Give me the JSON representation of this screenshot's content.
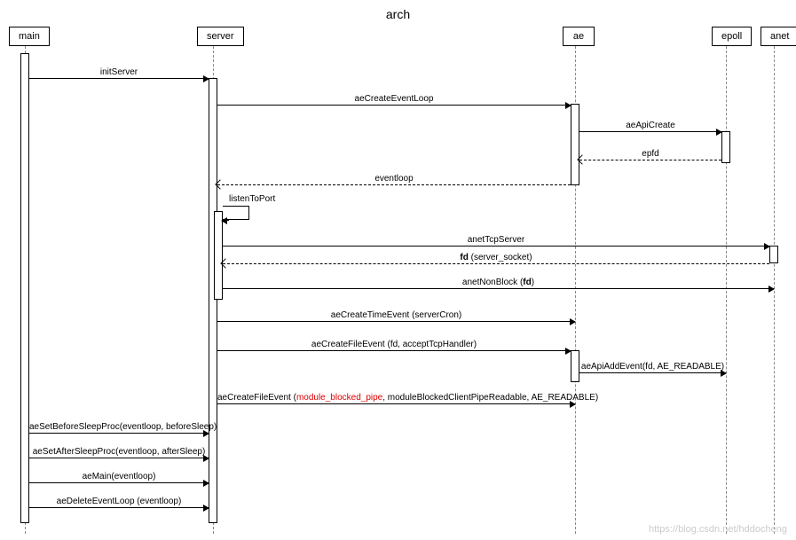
{
  "title": "arch",
  "participants": {
    "main": "main",
    "server": "server",
    "ae": "ae",
    "epoll": "epoll",
    "anet": "anet"
  },
  "messages": {
    "initServer": "initServer",
    "aeCreateEventLoop": "aeCreateEventLoop",
    "aeApiCreate": "aeApiCreate",
    "epfd": "epfd",
    "eventloop": "eventloop",
    "listenToPort": "listenToPort",
    "anetTcpServer": "anetTcpServer",
    "fdReturnPrefix": "fd",
    "fdReturnSuffix": " (server_socket)",
    "anetNonBlockPrefix": "anetNonBlock (",
    "anetNonBlockBold": "fd",
    "anetNonBlockSuffix": ")",
    "aeCreateTimeEvent": "aeCreateTimeEvent (serverCron)",
    "aeCreateFileEvent1": "aeCreateFileEvent (fd, acceptTcpHandler)",
    "aeApiAddEvent": "aeApiAddEvent(fd, AE_READABLE)",
    "aeCreateFileEvent2pre": "aeCreateFileEvent (",
    "aeCreateFileEvent2red": "module_blocked_pipe",
    "aeCreateFileEvent2post": ", moduleBlockedClientPipeReadable, AE_READABLE)",
    "aeSetBeforeSleepProc": "aeSetBeforeSleepProc(eventloop, beforeSleep)",
    "aeSetAfterSleepProc": "aeSetAfterSleepProc(eventloop, afterSleep)",
    "aeMain": "aeMain(eventloop)",
    "aeDeleteEventLoop": "aeDeleteEventLoop (eventloop)"
  },
  "watermark": "https://blog.csdn.net/hddocheng"
}
